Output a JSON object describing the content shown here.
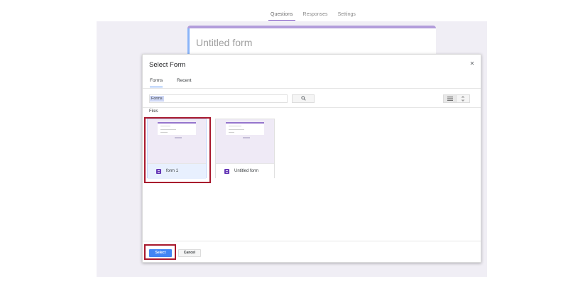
{
  "editor": {
    "tabs": [
      {
        "label": "Questions",
        "active": true
      },
      {
        "label": "Responses",
        "active": false
      },
      {
        "label": "Settings",
        "active": false
      }
    ],
    "form_title": "Untitled form"
  },
  "dialog": {
    "title": "Select Form",
    "close_glyph": "✕",
    "tabs": [
      {
        "label": "Forms",
        "active": true
      },
      {
        "label": "Recent",
        "active": false
      }
    ],
    "search": {
      "chip": "Forms",
      "value": ""
    },
    "files_label": "Files",
    "files": [
      {
        "name": "form 1",
        "selected": true,
        "icon": "form-icon"
      },
      {
        "name": "Untitled form",
        "selected": false,
        "icon": "form-icon"
      }
    ],
    "select_label": "Select",
    "cancel_label": "Cancel"
  },
  "colors": {
    "accent": "#4285f4",
    "form_purple": "#673ab7",
    "highlight": "#a8182d"
  }
}
